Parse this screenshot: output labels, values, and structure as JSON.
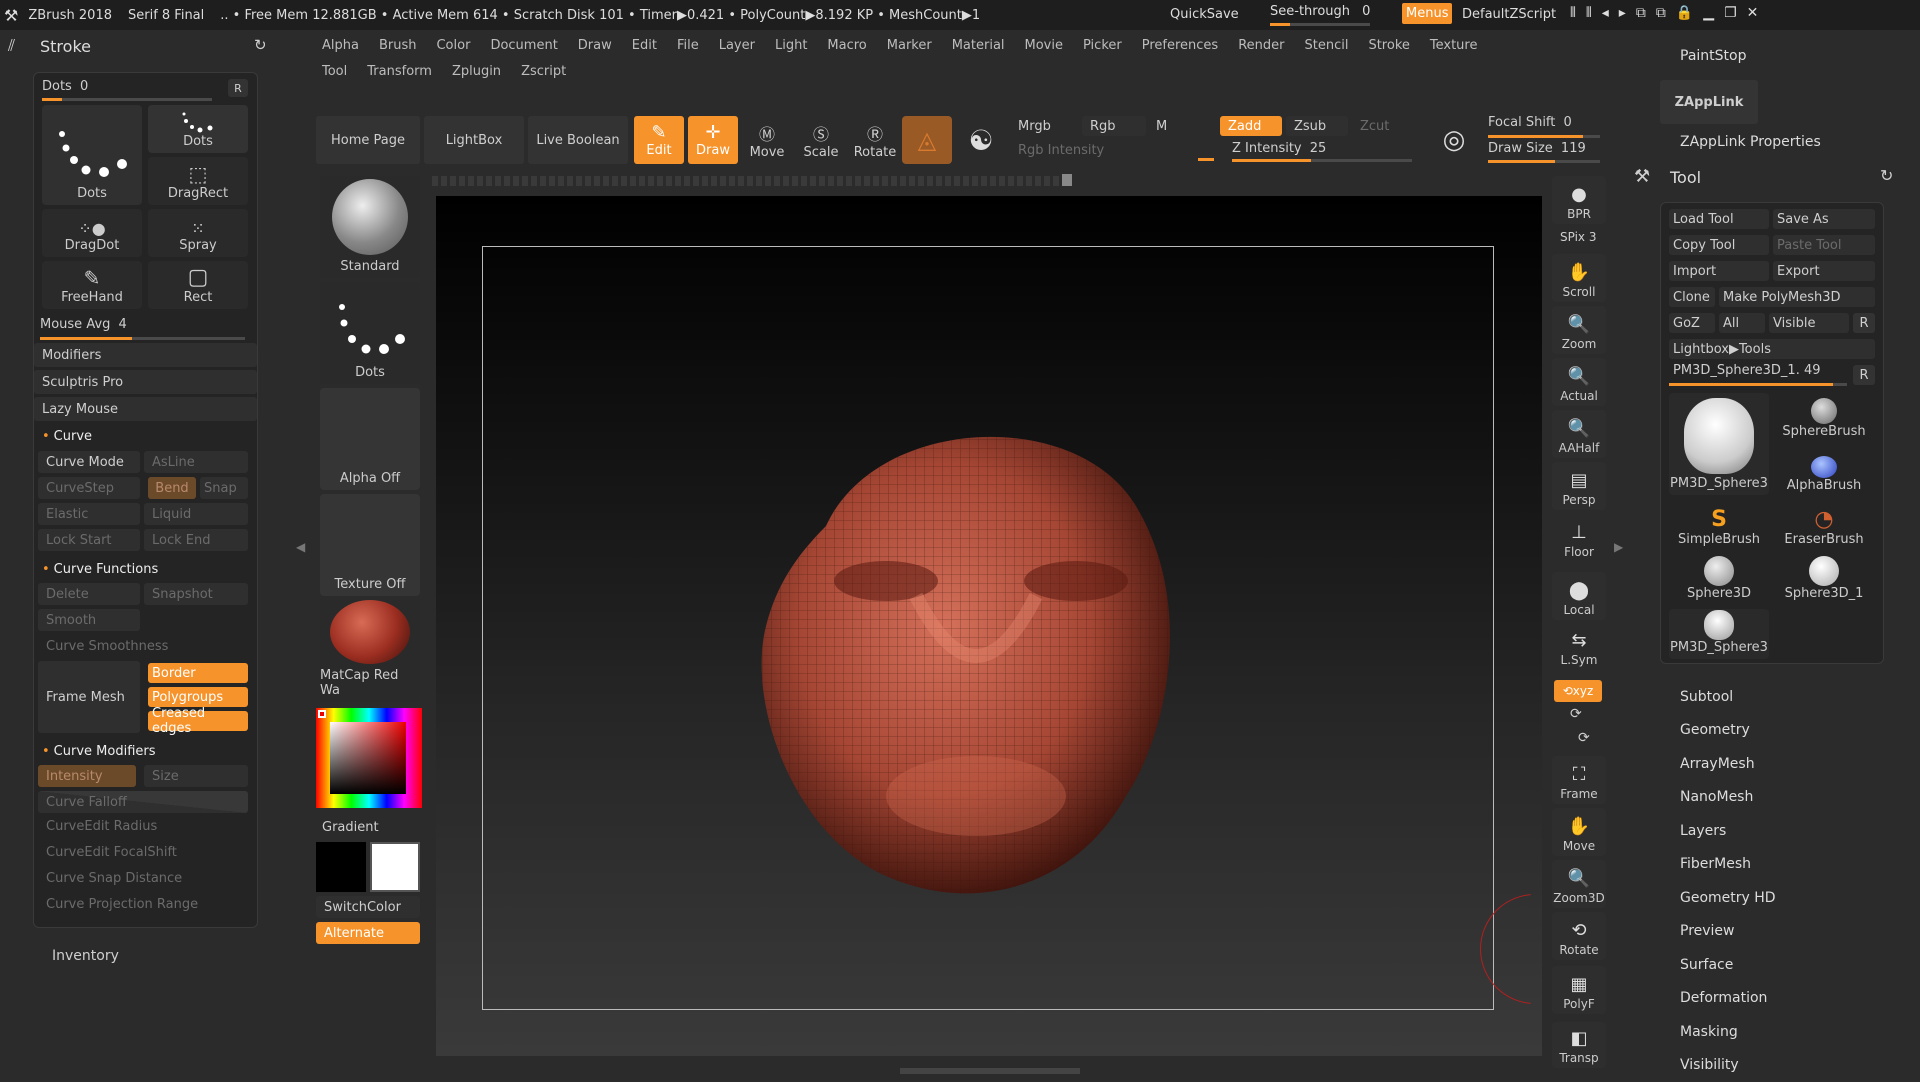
{
  "titlebar": {
    "app": "ZBrush 2018",
    "version": "Serif 8 Final",
    "status": ".. • Free Mem 12.881GB • Active Mem 614 • Scratch Disk 101 • Timer▶0.421 • PolyCount▶8.192 KP • MeshCount▶1",
    "quicksave": "QuickSave",
    "seethrough": "See-through",
    "seethrough_value": "0",
    "menus": "Menus",
    "script": "DefaultZScript"
  },
  "menubar": {
    "row1": [
      "Alpha",
      "Brush",
      "Color",
      "Document",
      "Draw",
      "Edit",
      "File",
      "Layer",
      "Light",
      "Macro",
      "Marker",
      "Material",
      "Movie",
      "Picker",
      "Preferences",
      "Render",
      "Stencil",
      "Stroke",
      "Texture"
    ],
    "row2": [
      "Tool",
      "Transform",
      "Zplugin",
      "Zscript"
    ]
  },
  "stroke": {
    "title": "Stroke",
    "dots_label": "Dots",
    "dots_value": "0",
    "r": "R",
    "tiles": [
      "Dots",
      "Dots",
      "DragRect",
      "DragDot",
      "Spray",
      "FreeHand",
      "Rect"
    ],
    "mouse_avg_label": "Mouse Avg",
    "mouse_avg_value": "4",
    "modifiers": "Modifiers",
    "sculptris": "Sculptris Pro",
    "lazy_mouse": "Lazy Mouse",
    "curve": "Curve",
    "curve_mode": "Curve Mode",
    "asline": "AsLine",
    "curvestep": "CurveStep",
    "bend": "Bend",
    "snap": "Snap",
    "elastic": "Elastic",
    "liquid": "Liquid",
    "lock_start": "Lock Start",
    "lock_end": "Lock End",
    "curve_functions": "Curve Functions",
    "delete": "Delete",
    "snapshot": "Snapshot",
    "smooth": "Smooth",
    "curve_smoothness": "Curve Smoothness",
    "frame_mesh": "Frame Mesh",
    "border": "Border",
    "polygroups": "Polygroups",
    "creased": "Creased edges",
    "curve_modifiers": "Curve Modifiers",
    "intensity": "Intensity",
    "size": "Size",
    "curve_falloff": "Curve Falloff",
    "curveedit_radius": "CurveEdit Radius",
    "curveedit_focal": "CurveEdit FocalShift",
    "curve_snap": "Curve Snap Distance",
    "curve_projection": "Curve Projection Range",
    "inventory": "Inventory"
  },
  "shelf": {
    "home": "Home Page",
    "lightbox": "LightBox",
    "live_boolean": "Live Boolean",
    "edit": "Edit",
    "draw": "Draw",
    "move": "Move",
    "scale": "Scale",
    "rotate": "Rotate",
    "mrgb": "Mrgb",
    "rgb": "Rgb",
    "m": "M",
    "rgb_intensity": "Rgb Intensity",
    "zadd": "Zadd",
    "zsub": "Zsub",
    "zcut": "Zcut",
    "z_intensity_label": "Z Intensity",
    "z_intensity_value": "25",
    "focal_label": "Focal Shift",
    "focal_value": "0",
    "draw_size_label": "Draw Size",
    "draw_size_value": "119"
  },
  "brushcol": {
    "standard": "Standard",
    "dots": "Dots",
    "alpha": "Alpha Off",
    "texture": "Texture Off",
    "matcap": "MatCap Red Wa",
    "gradient": "Gradient",
    "switchcolor": "SwitchColor",
    "alternate": "Alternate"
  },
  "dock": [
    "BPR",
    "SPix 3",
    "Scroll",
    "Zoom",
    "Actual",
    "AAHalf",
    "Persp",
    "Floor",
    "Local",
    "L.Sym",
    "Frame",
    "Move",
    "Zoom3D",
    "Rotate",
    "PolyF",
    "Transp"
  ],
  "right": {
    "paintstop": "PaintStop",
    "zapplink": "ZAppLink",
    "zapplink_props": "ZAppLink Properties",
    "tool": "Tool",
    "load_tool": "Load Tool",
    "save_as": "Save As",
    "copy_tool": "Copy Tool",
    "paste_tool": "Paste Tool",
    "import": "Import",
    "export": "Export",
    "clone": "Clone",
    "make_polymesh": "Make PolyMesh3D",
    "goz": "GoZ",
    "all": "All",
    "visible": "Visible",
    "r": "R",
    "lightbox_tools": "Lightbox▶Tools",
    "current": "PM3D_Sphere3D_1. 49",
    "tools": [
      "PM3D_Sphere3",
      "SphereBrush",
      "AlphaBrush",
      "SimpleBrush",
      "EraserBrush",
      "Sphere3D",
      "Sphere3D_1",
      "PM3D_Sphere3"
    ],
    "sections": [
      "Subtool",
      "Geometry",
      "ArrayMesh",
      "NanoMesh",
      "Layers",
      "FiberMesh",
      "Geometry HD",
      "Preview",
      "Surface",
      "Deformation",
      "Masking",
      "Visibility"
    ]
  }
}
